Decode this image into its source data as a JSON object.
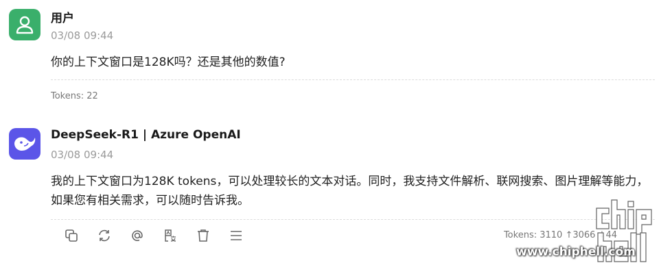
{
  "messages": [
    {
      "sender": "用户",
      "time": "03/08 09:44",
      "content": "你的上下文窗口是128K吗？还是其他的数值?",
      "tokens": "Tokens: 22"
    },
    {
      "sender": "DeepSeek-R1 | Azure OpenAI",
      "time": "03/08 09:44",
      "content": "我的上下文窗口为128K tokens，可以处理较长的文本对话。同时，我支持文件解析、联网搜索、图片理解等能力，如果您有相关需求，可以随时告诉我。",
      "tokens": "Tokens: 3110 ↑3066 ↓44"
    }
  ],
  "toolbar": {
    "icons": [
      "copy-icon",
      "regenerate-icon",
      "mention-icon",
      "translate-icon",
      "delete-icon",
      "menu-icon"
    ]
  },
  "watermark": {
    "url": "www.chiphell.com",
    "logo": "chiphell"
  },
  "colors": {
    "user_avatar": "#3aaf6b",
    "bot_avatar": "#5b55e8"
  }
}
